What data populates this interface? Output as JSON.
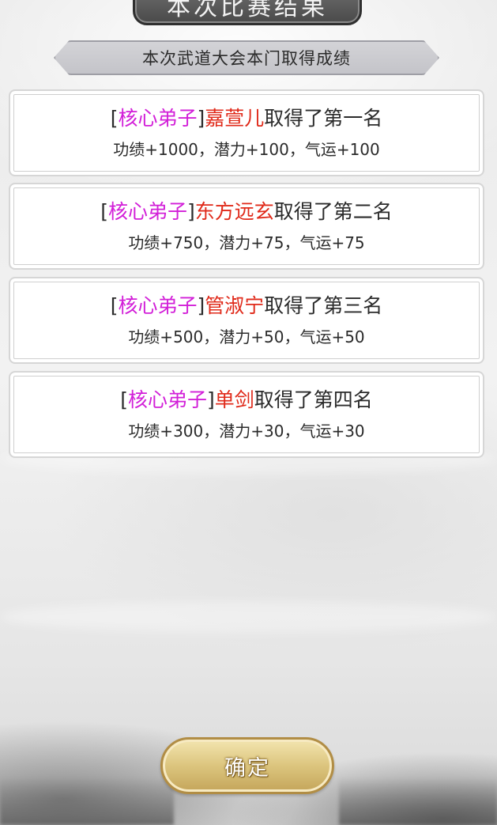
{
  "header": {
    "title": "本次比赛结果",
    "subtitle": "本次武道大会本门取得成绩"
  },
  "results": [
    {
      "bracket_open": "[",
      "tag": "核心弟子",
      "bracket_close": "]",
      "name": "嘉萱儿",
      "place": "取得了第一名",
      "reward": "功绩+1000，潜力+100，气运+100"
    },
    {
      "bracket_open": "[",
      "tag": "核心弟子",
      "bracket_close": "]",
      "name": "东方远玄",
      "place": "取得了第二名",
      "reward": "功绩+750，潜力+75，气运+75"
    },
    {
      "bracket_open": "[",
      "tag": "核心弟子",
      "bracket_close": "]",
      "name": "管淑宁",
      "place": "取得了第三名",
      "reward": "功绩+500，潜力+50，气运+50"
    },
    {
      "bracket_open": "[",
      "tag": "核心弟子",
      "bracket_close": "]",
      "name": "单剑",
      "place": "取得了第四名",
      "reward": "功绩+300，潜力+30，气运+30"
    }
  ],
  "footer": {
    "confirm_label": "确定"
  },
  "colors": {
    "tag": "#d21fd8",
    "name": "#e02a1a",
    "text": "#2b2b2b",
    "button_gold": "#dcc57e"
  }
}
